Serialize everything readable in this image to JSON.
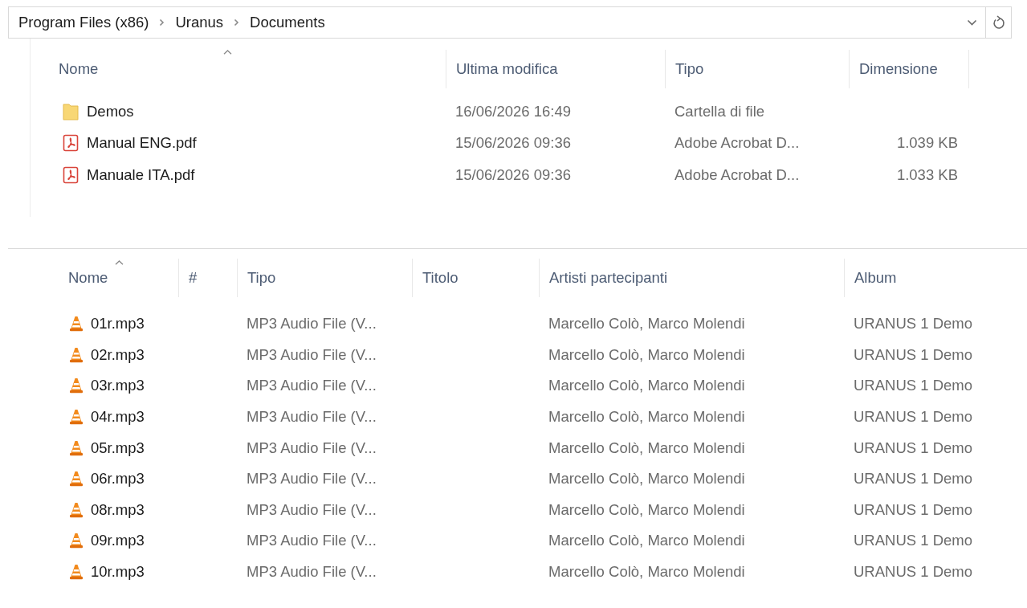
{
  "address_bar": {
    "breadcrumb": [
      "Program Files (x86)",
      "Uranus",
      "Documents"
    ]
  },
  "top_list": {
    "columns": [
      {
        "label": "Nome",
        "sorted": true
      },
      {
        "label": "Ultima modifica",
        "sorted": false
      },
      {
        "label": "Tipo",
        "sorted": false
      },
      {
        "label": "Dimensione",
        "sorted": false
      }
    ],
    "rows": [
      {
        "kind": "folder",
        "name": "Demos",
        "modified": "16/06/2026 16:49",
        "type": "Cartella di file"
      },
      {
        "kind": "pdf",
        "name": "Manual ENG.pdf",
        "modified": "15/06/2026 09:36",
        "type": "Adobe Acrobat D...",
        "size": "1.039 KB"
      },
      {
        "kind": "pdf",
        "name": "Manuale ITA.pdf",
        "modified": "15/06/2026 09:36",
        "type": "Adobe Acrobat D...",
        "size": "1.033 KB"
      }
    ]
  },
  "bottom_list": {
    "columns": [
      {
        "label": "Nome",
        "sorted": true
      },
      {
        "label": "#",
        "sorted": false
      },
      {
        "label": "Tipo",
        "sorted": false
      },
      {
        "label": "Titolo",
        "sorted": false
      },
      {
        "label": "Artisti partecipanti",
        "sorted": false
      },
      {
        "label": "Album",
        "sorted": false
      }
    ],
    "rows": [
      {
        "kind": "mp3",
        "name": "01r.mp3",
        "type": "MP3 Audio File (V...",
        "artists": "Marcello Colò, Marco Molendi",
        "album": "URANUS 1 Demo"
      },
      {
        "kind": "mp3",
        "name": "02r.mp3",
        "type": "MP3 Audio File (V...",
        "artists": "Marcello Colò, Marco Molendi",
        "album": "URANUS 1 Demo"
      },
      {
        "kind": "mp3",
        "name": "03r.mp3",
        "type": "MP3 Audio File (V...",
        "artists": "Marcello Colò, Marco Molendi",
        "album": "URANUS 1 Demo"
      },
      {
        "kind": "mp3",
        "name": "04r.mp3",
        "type": "MP3 Audio File (V...",
        "artists": "Marcello Colò, Marco Molendi",
        "album": "URANUS 1 Demo"
      },
      {
        "kind": "mp3",
        "name": "05r.mp3",
        "type": "MP3 Audio File (V...",
        "artists": "Marcello Colò, Marco Molendi",
        "album": "URANUS 1 Demo"
      },
      {
        "kind": "mp3",
        "name": "06r.mp3",
        "type": "MP3 Audio File (V...",
        "artists": "Marcello Colò, Marco Molendi",
        "album": "URANUS 1 Demo"
      },
      {
        "kind": "mp3",
        "name": "08r.mp3",
        "type": "MP3 Audio File (V...",
        "artists": "Marcello Colò, Marco Molendi",
        "album": "URANUS 1 Demo"
      },
      {
        "kind": "mp3",
        "name": "09r.mp3",
        "type": "MP3 Audio File (V...",
        "artists": "Marcello Colò, Marco Molendi",
        "album": "URANUS 1 Demo"
      },
      {
        "kind": "mp3",
        "name": "10r.mp3",
        "type": "MP3 Audio File (V...",
        "artists": "Marcello Colò, Marco Molendi",
        "album": "URANUS 1 Demo"
      }
    ]
  }
}
